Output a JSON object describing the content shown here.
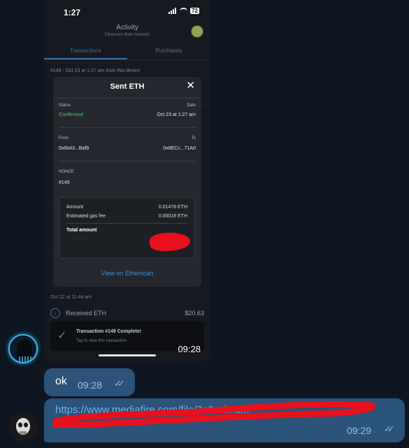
{
  "screenshot": {
    "status_time": "1:27",
    "battery": "72",
    "header_title": "Activity",
    "header_network": "Ethereum Main Network",
    "tabs": [
      {
        "label": "Transactions",
        "active": true
      },
      {
        "label": "Purchases",
        "active": false
      }
    ],
    "list_header": "#149 - Oct 23 at 1:27 am from this device",
    "modal": {
      "title": "Sent ETH",
      "status_label": "Status",
      "status_value": "Confirmed",
      "date_label": "Date",
      "date_value": "Oct 23 at 1:27 am",
      "from_label": "From",
      "from_value": "0x6b43...Baf9",
      "to_label": "To",
      "to_value": "0x8ECc...71A0",
      "nonce_label": "NONCE",
      "nonce_value": "#149",
      "amount_label": "Amount",
      "amount_value": "0.01478 ETH",
      "gas_label": "Estimated gas fee",
      "gas_value": "0.00018 ETH",
      "total_label": "Total amount",
      "link": "View on Etherscan"
    },
    "date_group": "Oct 22 at 11:44 am",
    "received_label": "Received ETH",
    "received_amount": "$20.63",
    "toast_title": "Transaction #149 Complete!",
    "toast_sub": "Tap to view this transaction"
  },
  "messages": {
    "photo_time": "09:28",
    "ok_text": "ok",
    "ok_time": "09:28",
    "link_text": "https://www.mediafire.com/file/3c0ssims...",
    "link_time": "09:29"
  },
  "colors": {
    "background": "#0e1621",
    "outgoing_bubble": "#2b5278",
    "link": "#6ab2f2",
    "redaction": "#e8101c"
  }
}
